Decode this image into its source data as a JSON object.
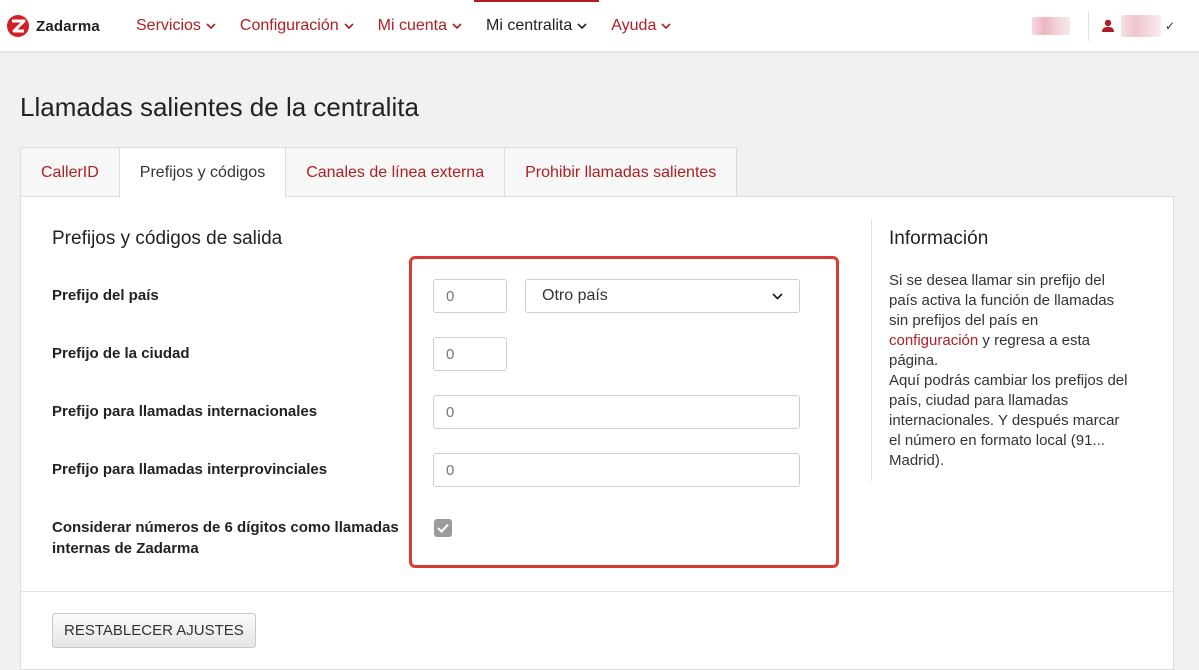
{
  "brand": {
    "name": "Zadarma",
    "accent": "#b01e23"
  },
  "nav": {
    "items": [
      {
        "label": "Servicios"
      },
      {
        "label": "Configuración"
      },
      {
        "label": "Mi cuenta"
      },
      {
        "label": "Mi centralita",
        "active": true
      },
      {
        "label": "Ayuda"
      }
    ]
  },
  "page": {
    "title": "Llamadas salientes de la centralita"
  },
  "tabs": [
    {
      "label": "CallerID"
    },
    {
      "label": "Prefijos y códigos",
      "active": true
    },
    {
      "label": "Canales de línea externa"
    },
    {
      "label": "Prohibir llamadas salientes"
    }
  ],
  "form": {
    "title": "Prefijos y códigos de salida",
    "country_prefix": {
      "label": "Prefijo del país",
      "placeholder": "0",
      "select_value": "Otro país"
    },
    "city_prefix": {
      "label": "Prefijo de la ciudad",
      "placeholder": "0"
    },
    "international_prefix": {
      "label": "Prefijo para llamadas internacionales",
      "placeholder": "0"
    },
    "interprovincial_prefix": {
      "label": "Prefijo para llamadas interprovinciales",
      "placeholder": "0"
    },
    "six_digit": {
      "label_line1": "Considerar números de 6 dígitos como llamadas",
      "label_line2": "internas de Zadarma",
      "checked": true
    }
  },
  "info": {
    "title": "Información",
    "text_before_link": "Si se desea llamar sin prefijo del país activa la función de llamadas sin prefijos del país en ",
    "link": "configuración",
    "text_after_link": " y regresa a esta página.",
    "paragraph2": "Aquí podrás cambiar los prefijos del país, ciudad para llamadas internacionales. Y después marcar el número en formato local (91... Madrid)."
  },
  "actions": {
    "reset_label": "RESTABLECER AJUSTES"
  },
  "colors": {
    "highlight": "#d93a3a",
    "checkbox": "#9b9b9b"
  }
}
